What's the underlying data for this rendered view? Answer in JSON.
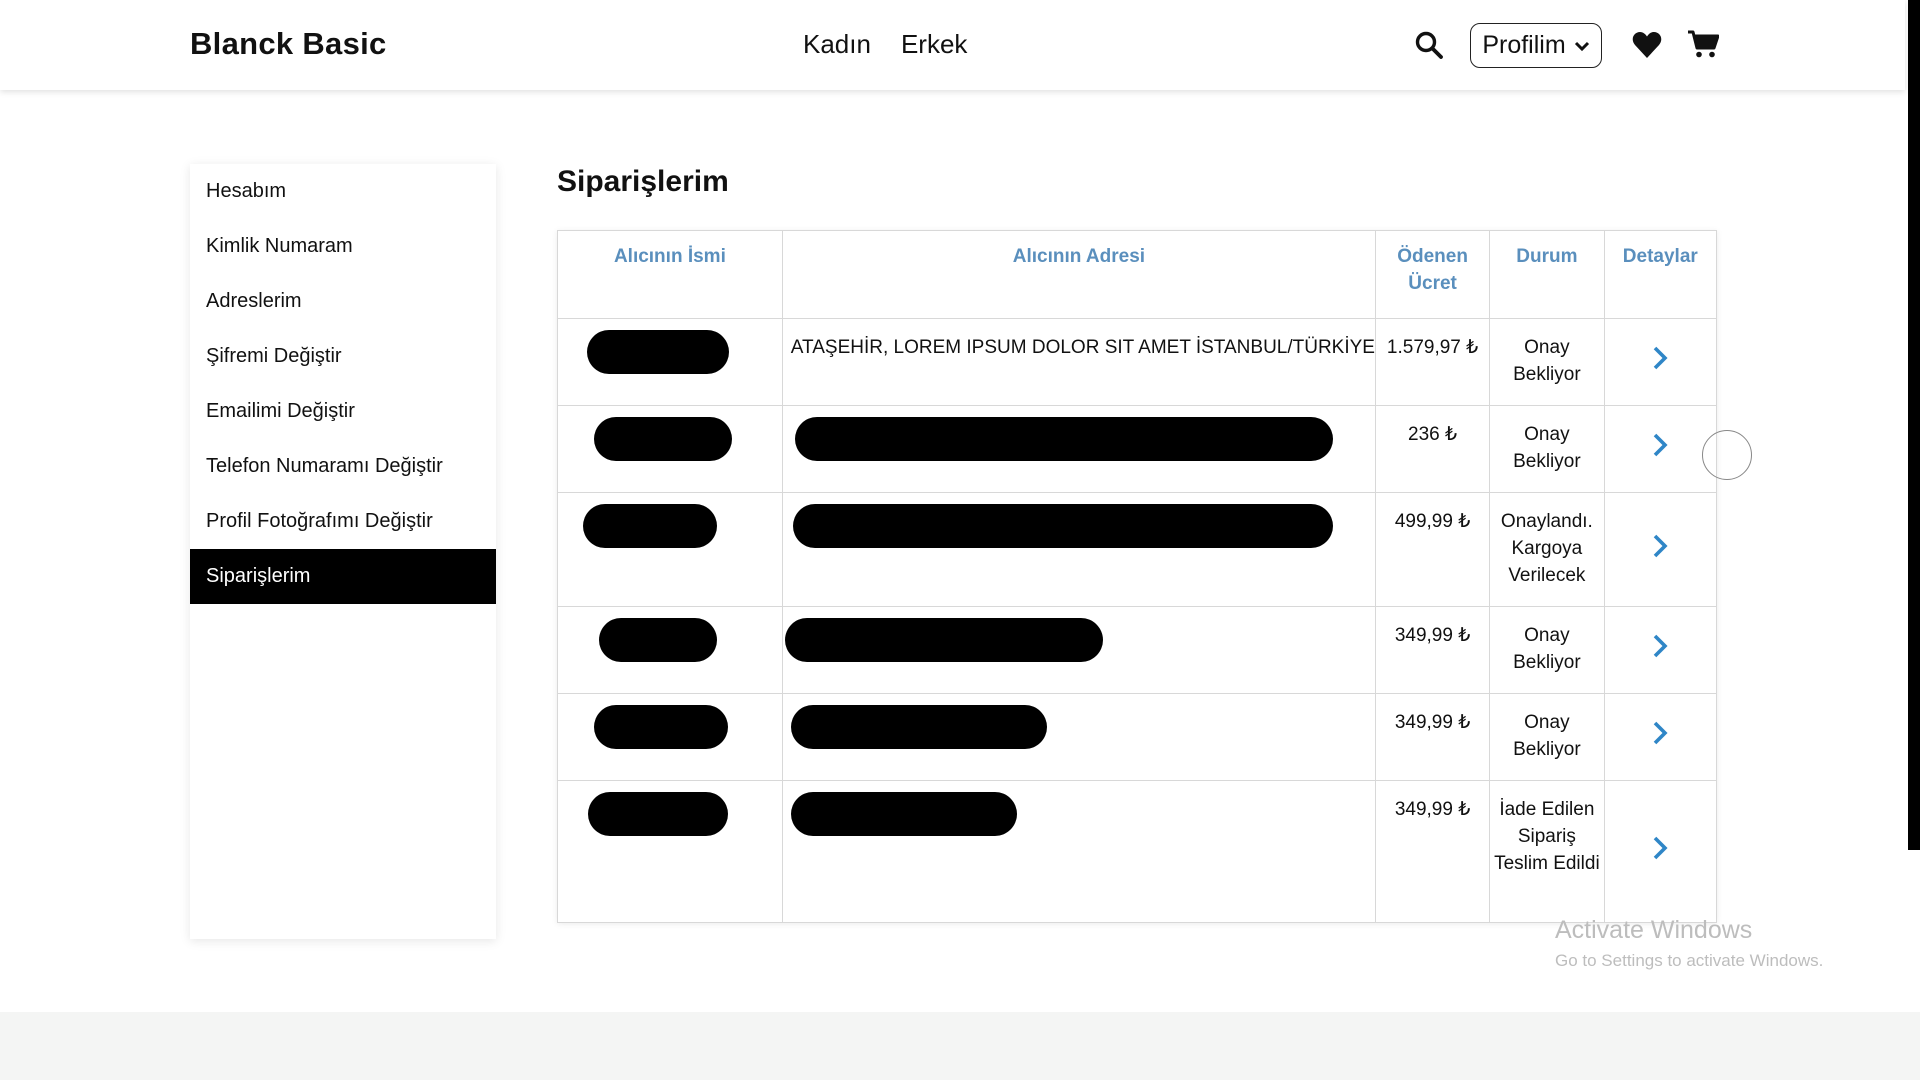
{
  "header": {
    "brand": "Blanck Basic",
    "nav": [
      "Kadın",
      "Erkek"
    ],
    "search_icon": "search-icon",
    "profile_label": "Profilim",
    "heart_icon": "heart-icon",
    "cart_icon": "cart-icon"
  },
  "sidebar": {
    "items": [
      {
        "label": "Hesabım",
        "active": false
      },
      {
        "label": "Kimlik Numaram",
        "active": false
      },
      {
        "label": "Adreslerim",
        "active": false
      },
      {
        "label": "Şifremi Değiştir",
        "active": false
      },
      {
        "label": "Emailimi Değiştir",
        "active": false
      },
      {
        "label": "Telefon Numaramı Değiştir",
        "active": false
      },
      {
        "label": "Profil Fotoğrafımı Değiştir",
        "active": false
      },
      {
        "label": "Siparişlerim",
        "active": true
      }
    ]
  },
  "main": {
    "title": "Siparişlerim",
    "columns": [
      "Alıcının İsmi",
      "Alıcının Adresi",
      "Ödenen Ücret",
      "Durum",
      "Detaylar"
    ],
    "rows": [
      {
        "name": "",
        "address": "ATAŞEHİR, LOREM IPSUM DOLOR SIT AMET İSTANBUL/TÜRKİYE",
        "price": "1.579,97 ₺",
        "status": "Onay Bekliyor"
      },
      {
        "name": "",
        "address": "",
        "price": "236 ₺",
        "status": "Onay Bekliyor"
      },
      {
        "name": "",
        "address": "",
        "price": "499,99 ₺",
        "status": "Onaylandı. Kargoya Verilecek"
      },
      {
        "name": "",
        "address": "",
        "price": "349,99 ₺",
        "status": "Onay Bekliyor"
      },
      {
        "name": "",
        "address": "",
        "price": "349,99 ₺",
        "status": "Onay Bekliyor"
      },
      {
        "name": "",
        "address": "",
        "price": "349,99 ₺",
        "status": "İade Edilen Sipariş Teslim Edildi"
      }
    ]
  },
  "windows_notice": {
    "line1": "Activate Windows",
    "line2": "Go to Settings to activate Windows."
  },
  "colors": {
    "accent_header": "#5a8fbd",
    "chevron": "#2f86c7",
    "active_bg": "#000000"
  }
}
